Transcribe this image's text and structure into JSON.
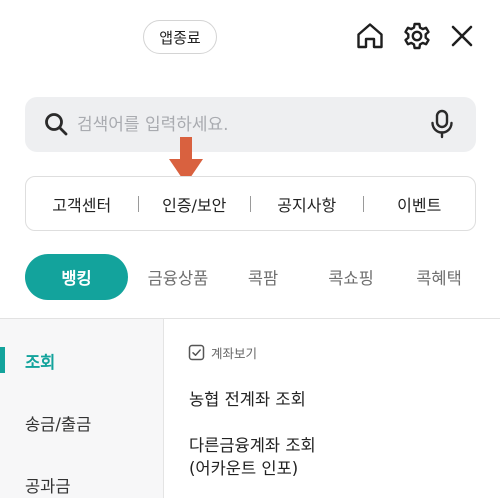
{
  "header": {
    "exit_label": "앱종료",
    "icons": [
      "home-icon",
      "gear-icon",
      "close-icon"
    ]
  },
  "search": {
    "placeholder": "검색어를 입력하세요.",
    "icons": [
      "search-icon",
      "mic-icon"
    ]
  },
  "quick_links": [
    {
      "label": "고객센터"
    },
    {
      "label": "인증/보안"
    },
    {
      "label": "공지사항"
    },
    {
      "label": "이벤트"
    }
  ],
  "annotation": {
    "arrow_color": "#d9613f",
    "icon": "down-arrow-icon"
  },
  "tabs": [
    {
      "label": "뱅킹",
      "active": true
    },
    {
      "label": "금융상품"
    },
    {
      "label": "콕팜"
    },
    {
      "label": "콕쇼핑"
    },
    {
      "label": "콕혜택"
    }
  ],
  "left_nav": [
    {
      "label": "조회",
      "active": true
    },
    {
      "label": "송금/출금"
    },
    {
      "label": "공과금"
    }
  ],
  "content": {
    "section_title": "계좌보기",
    "links": [
      {
        "line1": "농협 전계좌 조회"
      },
      {
        "line1": "다른금융계좌 조회",
        "line2": "(어카운트 인포)"
      }
    ]
  },
  "colors": {
    "accent": "#13a39c",
    "search_bg": "#eeeff1",
    "nav_bg": "#f7f7f8",
    "arrow": "#d9613f"
  }
}
